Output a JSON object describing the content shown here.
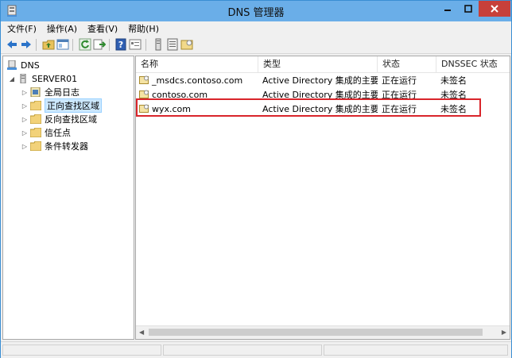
{
  "window": {
    "title": "DNS 管理器"
  },
  "menubar": {
    "items": [
      {
        "label": "文件(F)"
      },
      {
        "label": "操作(A)"
      },
      {
        "label": "查看(V)"
      },
      {
        "label": "帮助(H)"
      }
    ]
  },
  "toolbar": {
    "icons": [
      "back-icon",
      "forward-icon",
      "up-folder-icon",
      "show-tree-icon",
      "refresh-icon",
      "export-icon",
      "help-icon",
      "properties-icon",
      "server-icon",
      "record-icon",
      "zone-icon"
    ]
  },
  "tree": {
    "root": {
      "label": "DNS",
      "icon": "dns-icon"
    },
    "server": {
      "label": "SERVER01",
      "icon": "server-icon"
    },
    "children": [
      {
        "label": "全局日志",
        "icon": "log-icon"
      },
      {
        "label": "正向查找区域",
        "icon": "folder-icon",
        "selected": true
      },
      {
        "label": "反向查找区域",
        "icon": "folder-icon"
      },
      {
        "label": "信任点",
        "icon": "folder-icon"
      },
      {
        "label": "条件转发器",
        "icon": "folder-icon"
      }
    ]
  },
  "list": {
    "columns": [
      "名称",
      "类型",
      "状态",
      "DNSSEC 状态"
    ],
    "rows": [
      {
        "name": "_msdcs.contoso.com",
        "type": "Active Directory 集成的主要...",
        "status": "正在运行",
        "dnssec": "未签名"
      },
      {
        "name": "contoso.com",
        "type": "Active Directory 集成的主要...",
        "status": "正在运行",
        "dnssec": "未签名"
      },
      {
        "name": "wyx.com",
        "type": "Active Directory 集成的主要...",
        "status": "正在运行",
        "dnssec": "未签名"
      }
    ]
  },
  "colors": {
    "titlebar": "#6aaee8",
    "close_button": "#c7403a",
    "highlight_box": "#d9252b",
    "selection": "#cce8ff"
  }
}
